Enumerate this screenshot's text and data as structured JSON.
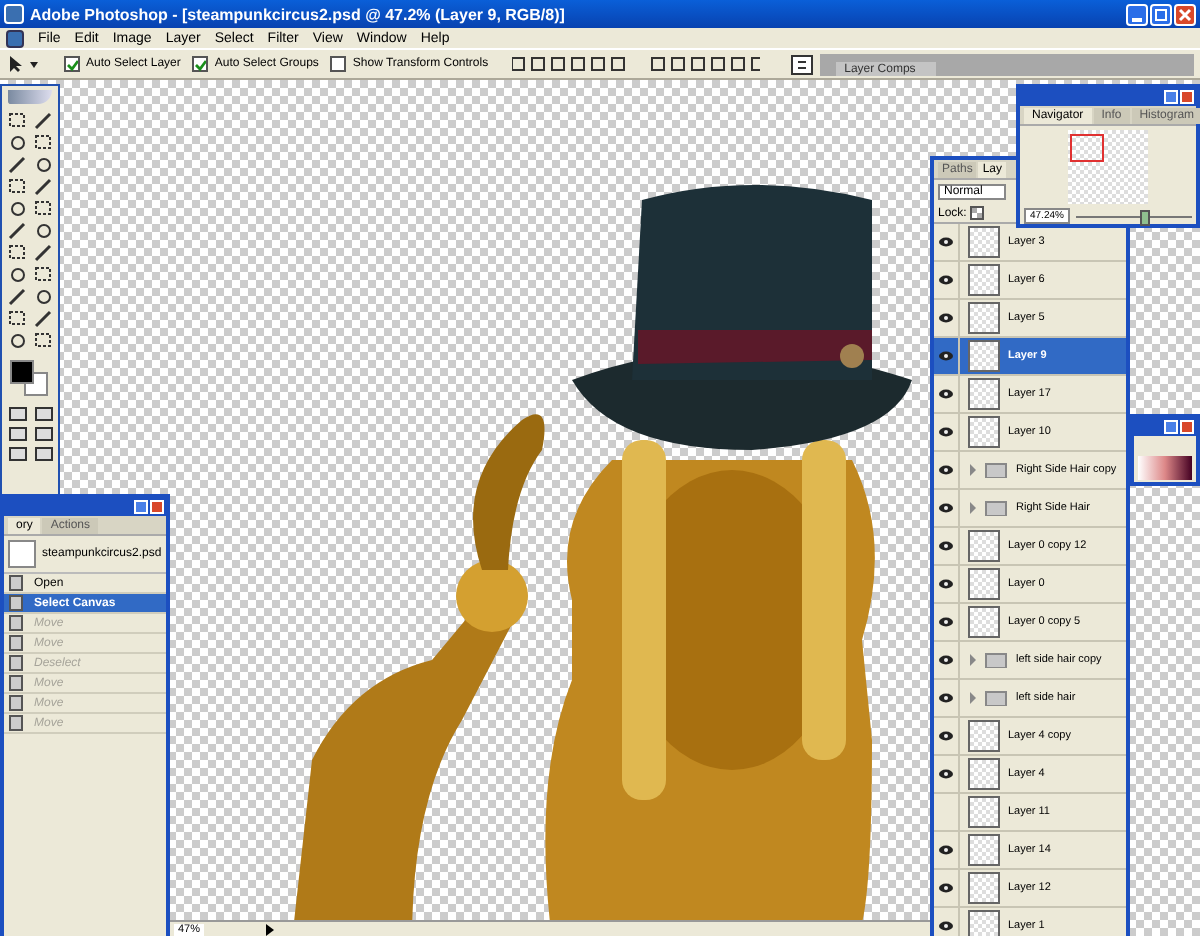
{
  "window": {
    "title": "Adobe Photoshop - [steampunkcircus2.psd @ 47.2% (Layer 9, RGB/8)]"
  },
  "menu": [
    "File",
    "Edit",
    "Image",
    "Layer",
    "Select",
    "Filter",
    "View",
    "Window",
    "Help"
  ],
  "options_bar": {
    "checkboxes": [
      {
        "label": "Auto Select Layer",
        "checked": true
      },
      {
        "label": "Auto Select Groups",
        "checked": true
      },
      {
        "label": "Show Transform Controls",
        "checked": false
      }
    ],
    "palette_well_tab": "Layer Comps"
  },
  "history_panel": {
    "tabs": [
      {
        "label": "ory",
        "selected": true
      },
      {
        "label": "Actions",
        "selected": false
      }
    ],
    "snapshot": "steampunkcircus2.psd",
    "steps": [
      {
        "label": "Open",
        "selected": false,
        "disabled": false
      },
      {
        "label": "Select Canvas",
        "selected": true,
        "disabled": false
      },
      {
        "label": "Move",
        "selected": false,
        "disabled": true
      },
      {
        "label": "Move",
        "selected": false,
        "disabled": true
      },
      {
        "label": "Deselect",
        "selected": false,
        "disabled": true
      },
      {
        "label": "Move",
        "selected": false,
        "disabled": true
      },
      {
        "label": "Move",
        "selected": false,
        "disabled": true
      },
      {
        "label": "Move",
        "selected": false,
        "disabled": true
      }
    ]
  },
  "navigator_panel": {
    "tabs": [
      {
        "label": "Navigator",
        "selected": true
      },
      {
        "label": "Info",
        "selected": false
      },
      {
        "label": "Histogram",
        "selected": false
      }
    ],
    "zoom": "47.24%",
    "level": 0.55
  },
  "layers_panel": {
    "tabs": [
      {
        "label": "Paths",
        "selected": false
      },
      {
        "label": "Lay",
        "selected": true
      }
    ],
    "blend_mode": "Normal",
    "lock_label": "Lock:",
    "layers": [
      {
        "name": "Layer 3",
        "kind": "layer",
        "visible": true,
        "selected": false
      },
      {
        "name": "Layer 6",
        "kind": "layer",
        "visible": true,
        "selected": false
      },
      {
        "name": "Layer 5",
        "kind": "layer",
        "visible": true,
        "selected": false
      },
      {
        "name": "Layer 9",
        "kind": "layer",
        "visible": true,
        "selected": true
      },
      {
        "name": "Layer 17",
        "kind": "layer",
        "visible": true,
        "selected": false
      },
      {
        "name": "Layer 10",
        "kind": "layer",
        "visible": true,
        "selected": false
      },
      {
        "name": "Right Side Hair copy",
        "kind": "group",
        "visible": true,
        "selected": false
      },
      {
        "name": "Right Side Hair",
        "kind": "group",
        "visible": true,
        "selected": false
      },
      {
        "name": "Layer 0 copy 12",
        "kind": "layer",
        "visible": true,
        "selected": false
      },
      {
        "name": "Layer 0",
        "kind": "layer",
        "visible": true,
        "selected": false
      },
      {
        "name": "Layer 0 copy 5",
        "kind": "layer",
        "visible": true,
        "selected": false
      },
      {
        "name": "left side hair copy",
        "kind": "group",
        "visible": true,
        "selected": false
      },
      {
        "name": "left side hair",
        "kind": "group",
        "visible": true,
        "selected": false
      },
      {
        "name": "Layer 4 copy",
        "kind": "layer",
        "visible": true,
        "selected": false
      },
      {
        "name": "Layer 4",
        "kind": "layer",
        "visible": true,
        "selected": false
      },
      {
        "name": "Layer 11",
        "kind": "layer",
        "visible": false,
        "selected": false
      },
      {
        "name": "Layer 14",
        "kind": "layer",
        "visible": true,
        "selected": false
      },
      {
        "name": "Layer 12",
        "kind": "layer",
        "visible": true,
        "selected": false
      },
      {
        "name": "Layer 1",
        "kind": "layer",
        "visible": true,
        "selected": false
      }
    ]
  },
  "status_bar": {
    "zoom": "47%"
  }
}
